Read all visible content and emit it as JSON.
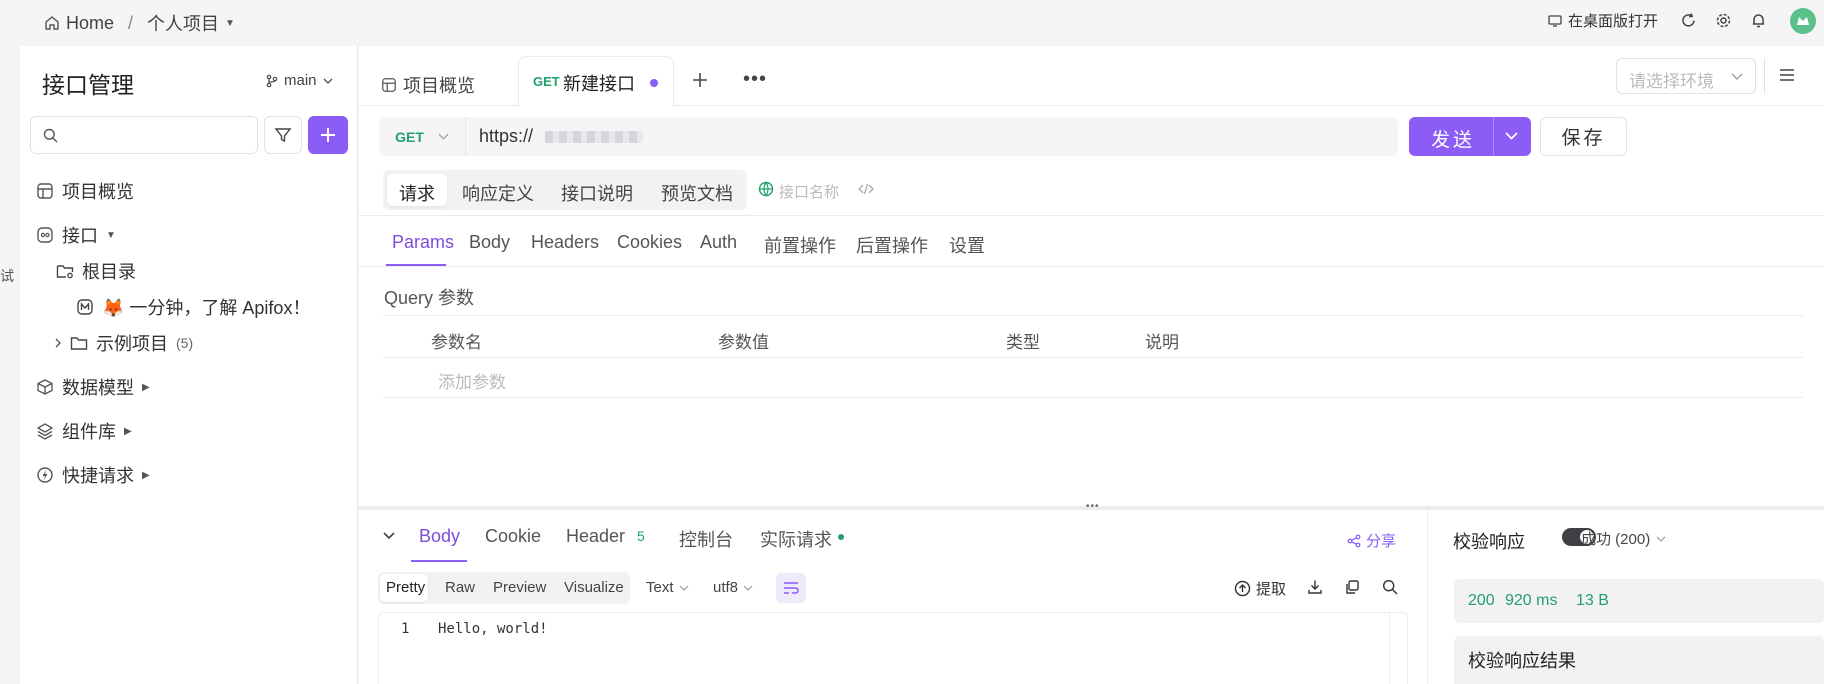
{
  "breadcrumb": {
    "home": "Home",
    "sep": "/",
    "project": "个人项目"
  },
  "topbar": {
    "open_desktop": "在桌面版打开"
  },
  "left": {
    "title": "接口管理",
    "branch": "main",
    "side_edge_text": "试",
    "tree": {
      "overview": "项目概览",
      "apis": "接口",
      "root": "根目录",
      "doc": "🦊 一分钟，了解 Apifox！",
      "example": "示例项目",
      "example_count": "(5)",
      "models": "数据模型",
      "components": "组件库",
      "quick": "快捷请求"
    }
  },
  "tabs": {
    "overview": "项目概览",
    "active_method": "GET",
    "active_label": "新建接口"
  },
  "env": {
    "placeholder": "请选择环境"
  },
  "request": {
    "method": "GET",
    "url": "https://",
    "send": "发送",
    "save": "保存"
  },
  "modes": [
    "请求",
    "响应定义",
    "接口说明",
    "预览文档"
  ],
  "api_name_placeholder": "接口名称",
  "param_tabs": [
    "Params",
    "Body",
    "Headers",
    "Cookies",
    "Auth",
    "前置操作",
    "后置操作",
    "设置"
  ],
  "query": {
    "title": "Query 参数",
    "columns": [
      "参数名",
      "参数值",
      "类型",
      "说明"
    ],
    "add": "添加参数"
  },
  "response": {
    "tabs": {
      "body": "Body",
      "cookie": "Cookie",
      "header": "Header",
      "header_count": "5",
      "console": "控制台",
      "actual": "实际请求"
    },
    "share": "分享",
    "formats": [
      "Pretty",
      "Raw",
      "Preview",
      "Visualize"
    ],
    "type": "Text",
    "encoding": "utf8",
    "extract": "提取",
    "line_no": "1",
    "body_text": "Hello, world!"
  },
  "validate": {
    "label": "校验响应",
    "status_select": "成功 (200)",
    "status": "200",
    "time": "920 ms",
    "size": "13 B",
    "result_title": "校验响应结果"
  },
  "colors": {
    "accent": "#8b5cf6",
    "green": "#22a06b"
  }
}
